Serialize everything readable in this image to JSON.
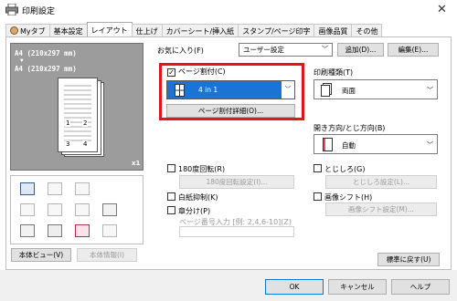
{
  "window": {
    "title": "印刷設定",
    "close_glyph": "✕"
  },
  "tabs": [
    {
      "label": "Myタブ"
    },
    {
      "label": "基本設定"
    },
    {
      "label": "レイアウト"
    },
    {
      "label": "仕上げ"
    },
    {
      "label": "カバーシート/挿入紙"
    },
    {
      "label": "スタンプ/ページ印字"
    },
    {
      "label": "画像品質"
    },
    {
      "label": "その他"
    }
  ],
  "preview": {
    "line1": "A4 (210x297 mm)",
    "arrow": "▼",
    "line2": "A4 (210x297 mm)",
    "page_numbers": [
      "1",
      "2",
      "3",
      "4"
    ],
    "copies": "x1"
  },
  "left_buttons": {
    "view": "本体ビュー(V)",
    "info": "本体情報(I)"
  },
  "favorites": {
    "label": "お気に入り(F)",
    "value": "ユーザー設定",
    "add": "追加(D)...",
    "edit": "編集(E)..."
  },
  "page_layout": {
    "checkbox_label": "ページ割付(C)",
    "checked": true,
    "combo_value": "4 in 1",
    "details_button": "ページ割付詳細(O)..."
  },
  "print_type": {
    "label": "印刷種類(T)",
    "value": "両面"
  },
  "binding": {
    "label": "開き方向/とじ方向(B)",
    "value": "自動"
  },
  "rotate180": {
    "label": "180度回転(R)",
    "button": "180度回転設定(I)..."
  },
  "staple": {
    "label": "とじしろ(G)",
    "button": "とじしろ設定(L)..."
  },
  "blank_suppress": {
    "label": "白紙抑制(K)"
  },
  "image_shift": {
    "label": "画像シフト(H)",
    "button": "画像シフト設定(M)..."
  },
  "chapter": {
    "label": "章分け(P)",
    "page_input_label": "ページ番号入力 [例: 2,4,6-10](Z)"
  },
  "restore_button": "標準に戻す(U)",
  "dialog_buttons": {
    "ok": "OK",
    "cancel": "キャンセル",
    "help": "ヘルプ"
  },
  "colors": {
    "accent": "#1b73d3",
    "highlight": "#e3141a"
  }
}
